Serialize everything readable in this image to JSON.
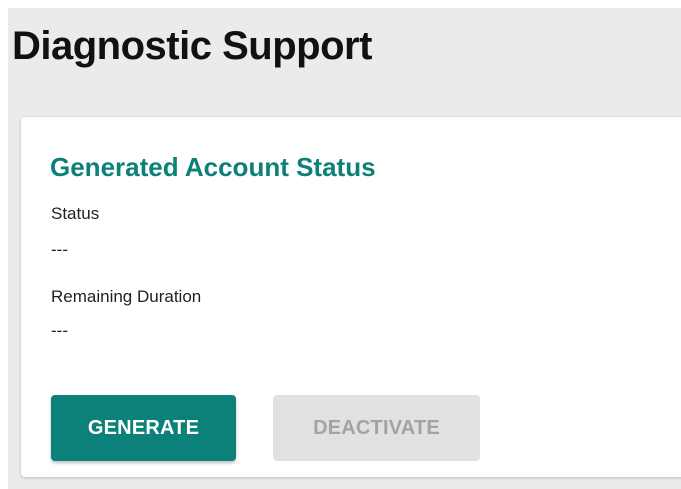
{
  "page": {
    "title": "Diagnostic Support"
  },
  "card": {
    "title": "Generated Account Status",
    "fields": [
      {
        "label": "Status",
        "value": "---"
      },
      {
        "label": "Remaining Duration",
        "value": "---"
      }
    ]
  },
  "actions": {
    "generate_label": "GENERATE",
    "deactivate_label": "DEACTIVATE"
  },
  "colors": {
    "accent": "#0b8179",
    "page_background": "#ebebeb",
    "disabled_button": "#e1e1e1",
    "disabled_text": "#a3a3a3"
  }
}
